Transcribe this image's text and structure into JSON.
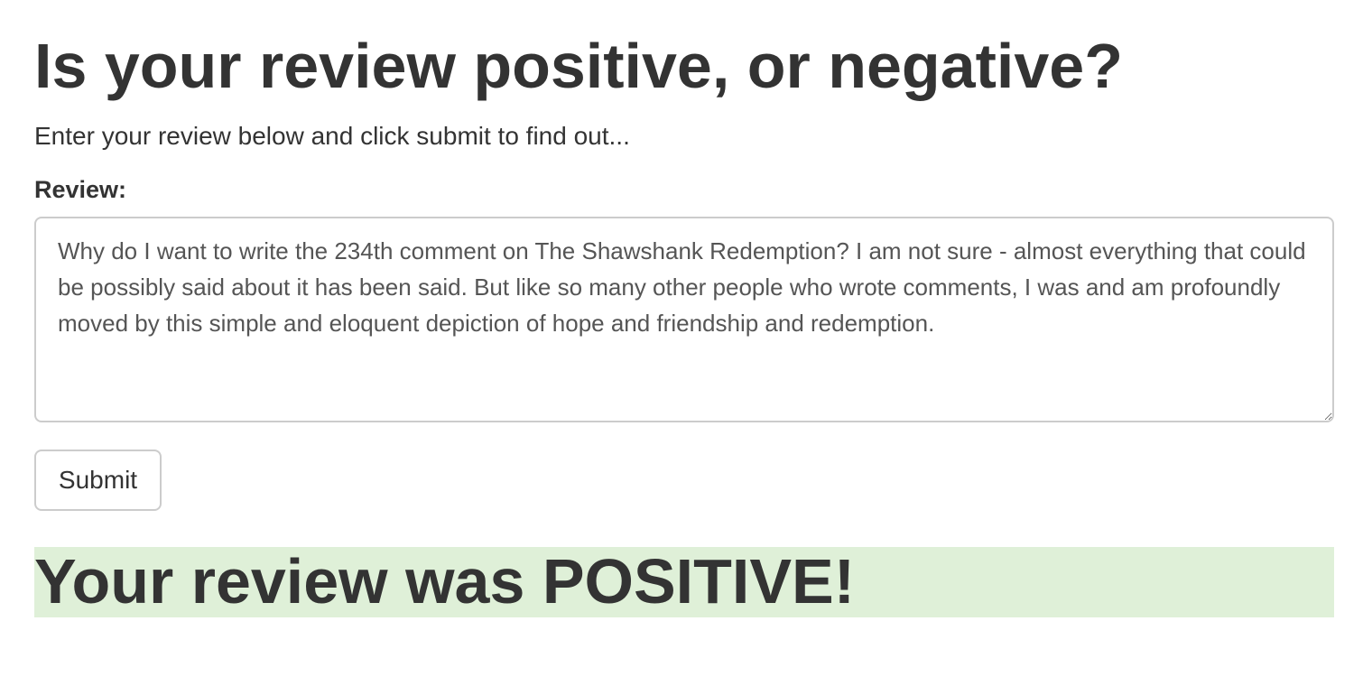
{
  "header": {
    "title": "Is your review positive, or negative?",
    "subtitle": "Enter your review below and click submit to find out..."
  },
  "form": {
    "review_label": "Review:",
    "review_value": "Why do I want to write the 234th comment on The Shawshank Redemption? I am not sure - almost everything that could be possibly said about it has been said. But like so many other people who wrote comments, I was and am profoundly moved by this simple and eloquent depiction of hope and friendship and redemption.",
    "submit_label": "Submit"
  },
  "result": {
    "text": "Your review was POSITIVE!",
    "background_color": "#dff0d8"
  }
}
